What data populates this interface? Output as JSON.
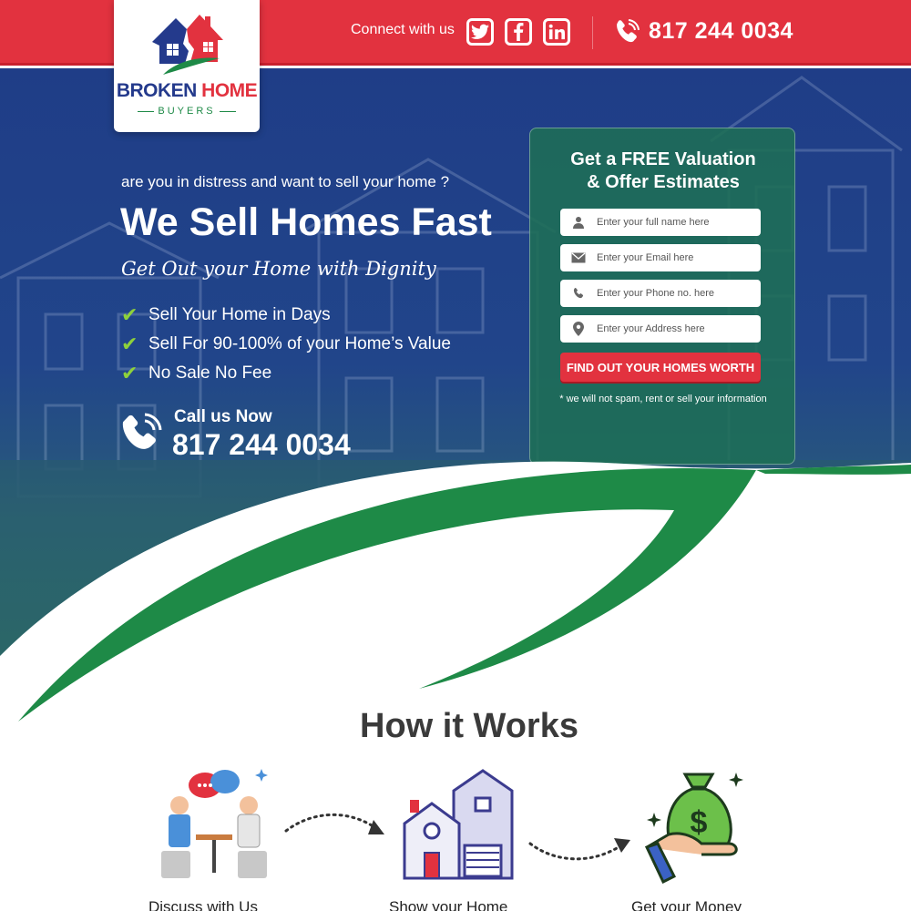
{
  "topbar": {
    "connect_label": "Connect with us",
    "social": [
      {
        "name": "twitter-icon",
        "glyph": "t"
      },
      {
        "name": "facebook-icon",
        "glyph": "f"
      },
      {
        "name": "linkedin-icon",
        "glyph": "in"
      }
    ],
    "phone": "817 244 0034"
  },
  "logo": {
    "line1_a": "BROKEN",
    "line1_b": "HOME",
    "line2": "BUYERS"
  },
  "hero": {
    "tagline": "are you in distress and want to sell your home ?",
    "headline": "We Sell Homes Fast",
    "script": "Get Out your Home with Dignity",
    "bullets": [
      "Sell Your Home in Days",
      "Sell For 90-100% of your Home’s Value",
      "No Sale No Fee"
    ],
    "call_label": "Call us Now",
    "call_number": "817 244 0034"
  },
  "form": {
    "title_line1": "Get a FREE Valuation",
    "title_line2": "& Offer Estimates",
    "fields": [
      {
        "placeholder": "Enter your full name here",
        "icon": "user-icon"
      },
      {
        "placeholder": "Enter your Email here",
        "icon": "envelope-icon"
      },
      {
        "placeholder": "Enter your Phone no. here",
        "icon": "phone-icon"
      },
      {
        "placeholder": "Enter your Address here",
        "icon": "location-pin-icon"
      }
    ],
    "cta": "FIND OUT YOUR HOMES WORTH",
    "disclaimer": "* we will not spam, rent or sell your information"
  },
  "how": {
    "title": "How it Works",
    "steps": [
      {
        "label": "Discuss with Us",
        "icon": "discussion-icon"
      },
      {
        "label": "Show your Home",
        "icon": "house-icon"
      },
      {
        "label": "Get your Money",
        "icon": "money-bag-icon"
      }
    ]
  },
  "colors": {
    "brand_red": "#e2323f",
    "brand_blue": "#243a8c",
    "brand_green": "#1e8a47"
  }
}
